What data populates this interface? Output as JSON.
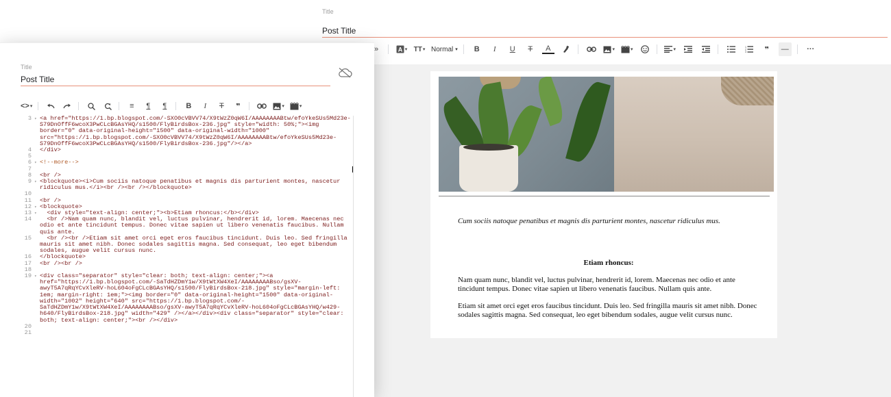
{
  "compose": {
    "title_label": "Title",
    "title_value": "Post Title",
    "toolbar": {
      "text_color_label": "A",
      "font_size_label": "TT",
      "format_label": "Normal",
      "bold_label": "B",
      "italic_label": "I",
      "underline_label": "U",
      "strike_label": "T",
      "color_label": "A",
      "quote_label": "❞",
      "hr_label": "—",
      "more_label": "···"
    },
    "content": {
      "quote": "Cum sociis natoque penatibus et magnis dis parturient montes, nascetur ridiculus mus.",
      "heading": "Etiam rhoncus:",
      "para1": "Nam quam nunc, blandit vel, luctus pulvinar, hendrerit id, lorem. Maecenas nec odio et ante tincidunt tempus. Donec vitae sapien ut libero venenatis faucibus. Nullam quis ante.",
      "para2": "Etiam sit amet orci eget eros faucibus tincidunt. Duis leo. Sed fringilla mauris sit amet nibh. Donec sodales sagittis magna. Sed consequat, leo eget bibendum sodales, augue velit cursus nunc."
    }
  },
  "html_view": {
    "title_label": "Title",
    "title_value": "Post Title",
    "toolbar": {
      "code_label": "<>",
      "bold_label": "B",
      "italic_label": "I",
      "strike_label": "T",
      "quote_label": "❞",
      "align_label": "≡",
      "ltr_label": "¶",
      "rtl_label": "¶"
    },
    "code_lines": [
      {
        "n": "3",
        "fold": "▾",
        "text": "<a href=\"https://1.bp.blogspot.com/-SXO0cVBVV74/X9tWzZ0qW6I/AAAAAAAABtw/efoYkeSUs5Md23e-S79DnOffF6wcoX3PwCLcBGAsYHQ/s1500/FlyBirdsBox-236.jpg\" style=\"width: 50%;\"><img border=\"0\" data-original-height=\"1500\" data-original-width=\"1000\" src=\"https://1.bp.blogspot.com/-SXO0cVBVV74/X9tWzZ0qW6I/AAAAAAAABtw/efoYkeSUs5Md23e-S79DnOffF6wcoX3PwCLcBGAsYHQ/s1500/FlyBirdsBox-236.jpg\"/></a>",
        "cls": ""
      },
      {
        "n": "4",
        "fold": "",
        "text": "</div>",
        "cls": ""
      },
      {
        "n": "5",
        "fold": "",
        "text": "",
        "cls": ""
      },
      {
        "n": "6",
        "fold": "▾",
        "text": "<!--more-->",
        "cls": "cmt"
      },
      {
        "n": "7",
        "fold": "",
        "text": "",
        "cls": "cursor"
      },
      {
        "n": "8",
        "fold": "",
        "text": "<br />",
        "cls": ""
      },
      {
        "n": "9",
        "fold": "▾",
        "text": "<blockquote><i>Cum sociis natoque penatibus et magnis dis parturient montes, nascetur ridiculus mus.</i><br /><br /></blockquote>",
        "cls": ""
      },
      {
        "n": "10",
        "fold": "",
        "text": "",
        "cls": ""
      },
      {
        "n": "11",
        "fold": "",
        "text": "<br />",
        "cls": ""
      },
      {
        "n": "12",
        "fold": "▾",
        "text": "<blockquote>",
        "cls": ""
      },
      {
        "n": "13",
        "fold": "▾",
        "text": "  <div style=\"text-align: center;\"><b>Etiam rhoncus:</b></div>",
        "cls": ""
      },
      {
        "n": "14",
        "fold": "",
        "text": "  <br />Nam quam nunc, blandit vel, luctus pulvinar, hendrerit id, lorem. Maecenas nec odio et ante tincidunt tempus. Donec vitae sapien ut libero venenatis faucibus. Nullam quis ante.",
        "cls": ""
      },
      {
        "n": "15",
        "fold": "",
        "text": "  <br /><br />Etiam sit amet orci eget eros faucibus tincidunt. Duis leo. Sed fringilla mauris sit amet nibh. Donec sodales sagittis magna. Sed consequat, leo eget bibendum sodales, augue velit cursus nunc.",
        "cls": ""
      },
      {
        "n": "16",
        "fold": "",
        "text": "</blockquote>",
        "cls": ""
      },
      {
        "n": "17",
        "fold": "",
        "text": "<br /><br />",
        "cls": ""
      },
      {
        "n": "18",
        "fold": "",
        "text": "",
        "cls": ""
      },
      {
        "n": "19",
        "fold": "▾",
        "text": "<div class=\"separator\" style=\"clear: both; text-align: center;\"><a href=\"https://1.bp.blogspot.com/-SaTdHZDmY1w/X9tWtXW4XeI/AAAAAAAABso/gsXV-awyT5A7qRqYCvXleRV-hoL604oFgCLcBGAsYHQ/s1500/FlyBirdsBox-218.jpg\" style=\"margin-left: 1em; margin-right: 1em;\"><img border=\"0\" data-original-height=\"1500\" data-original-width=\"1002\" height=\"640\" src=\"https://1.bp.blogspot.com/-SaTdHZDmY1w/X9tWtXW4XeI/AAAAAAAABso/gsXV-awyT5A7qRqYCvXleRV-hoL604oFgCLcBGAsYHQ/w429-h640/FlyBirdsBox-218.jpg\" width=\"429\" /></a></div><div class=\"separator\" style=\"clear: both; text-align: center;\"><br /></div>",
        "cls": ""
      },
      {
        "n": "20",
        "fold": "",
        "text": "",
        "cls": ""
      },
      {
        "n": "21",
        "fold": "",
        "text": "",
        "cls": ""
      }
    ]
  },
  "colors": {
    "accent_underline": "#e8907a",
    "code_tag": "#7a1a1a",
    "code_comment": "#b05a28",
    "line_number": "#999999"
  }
}
